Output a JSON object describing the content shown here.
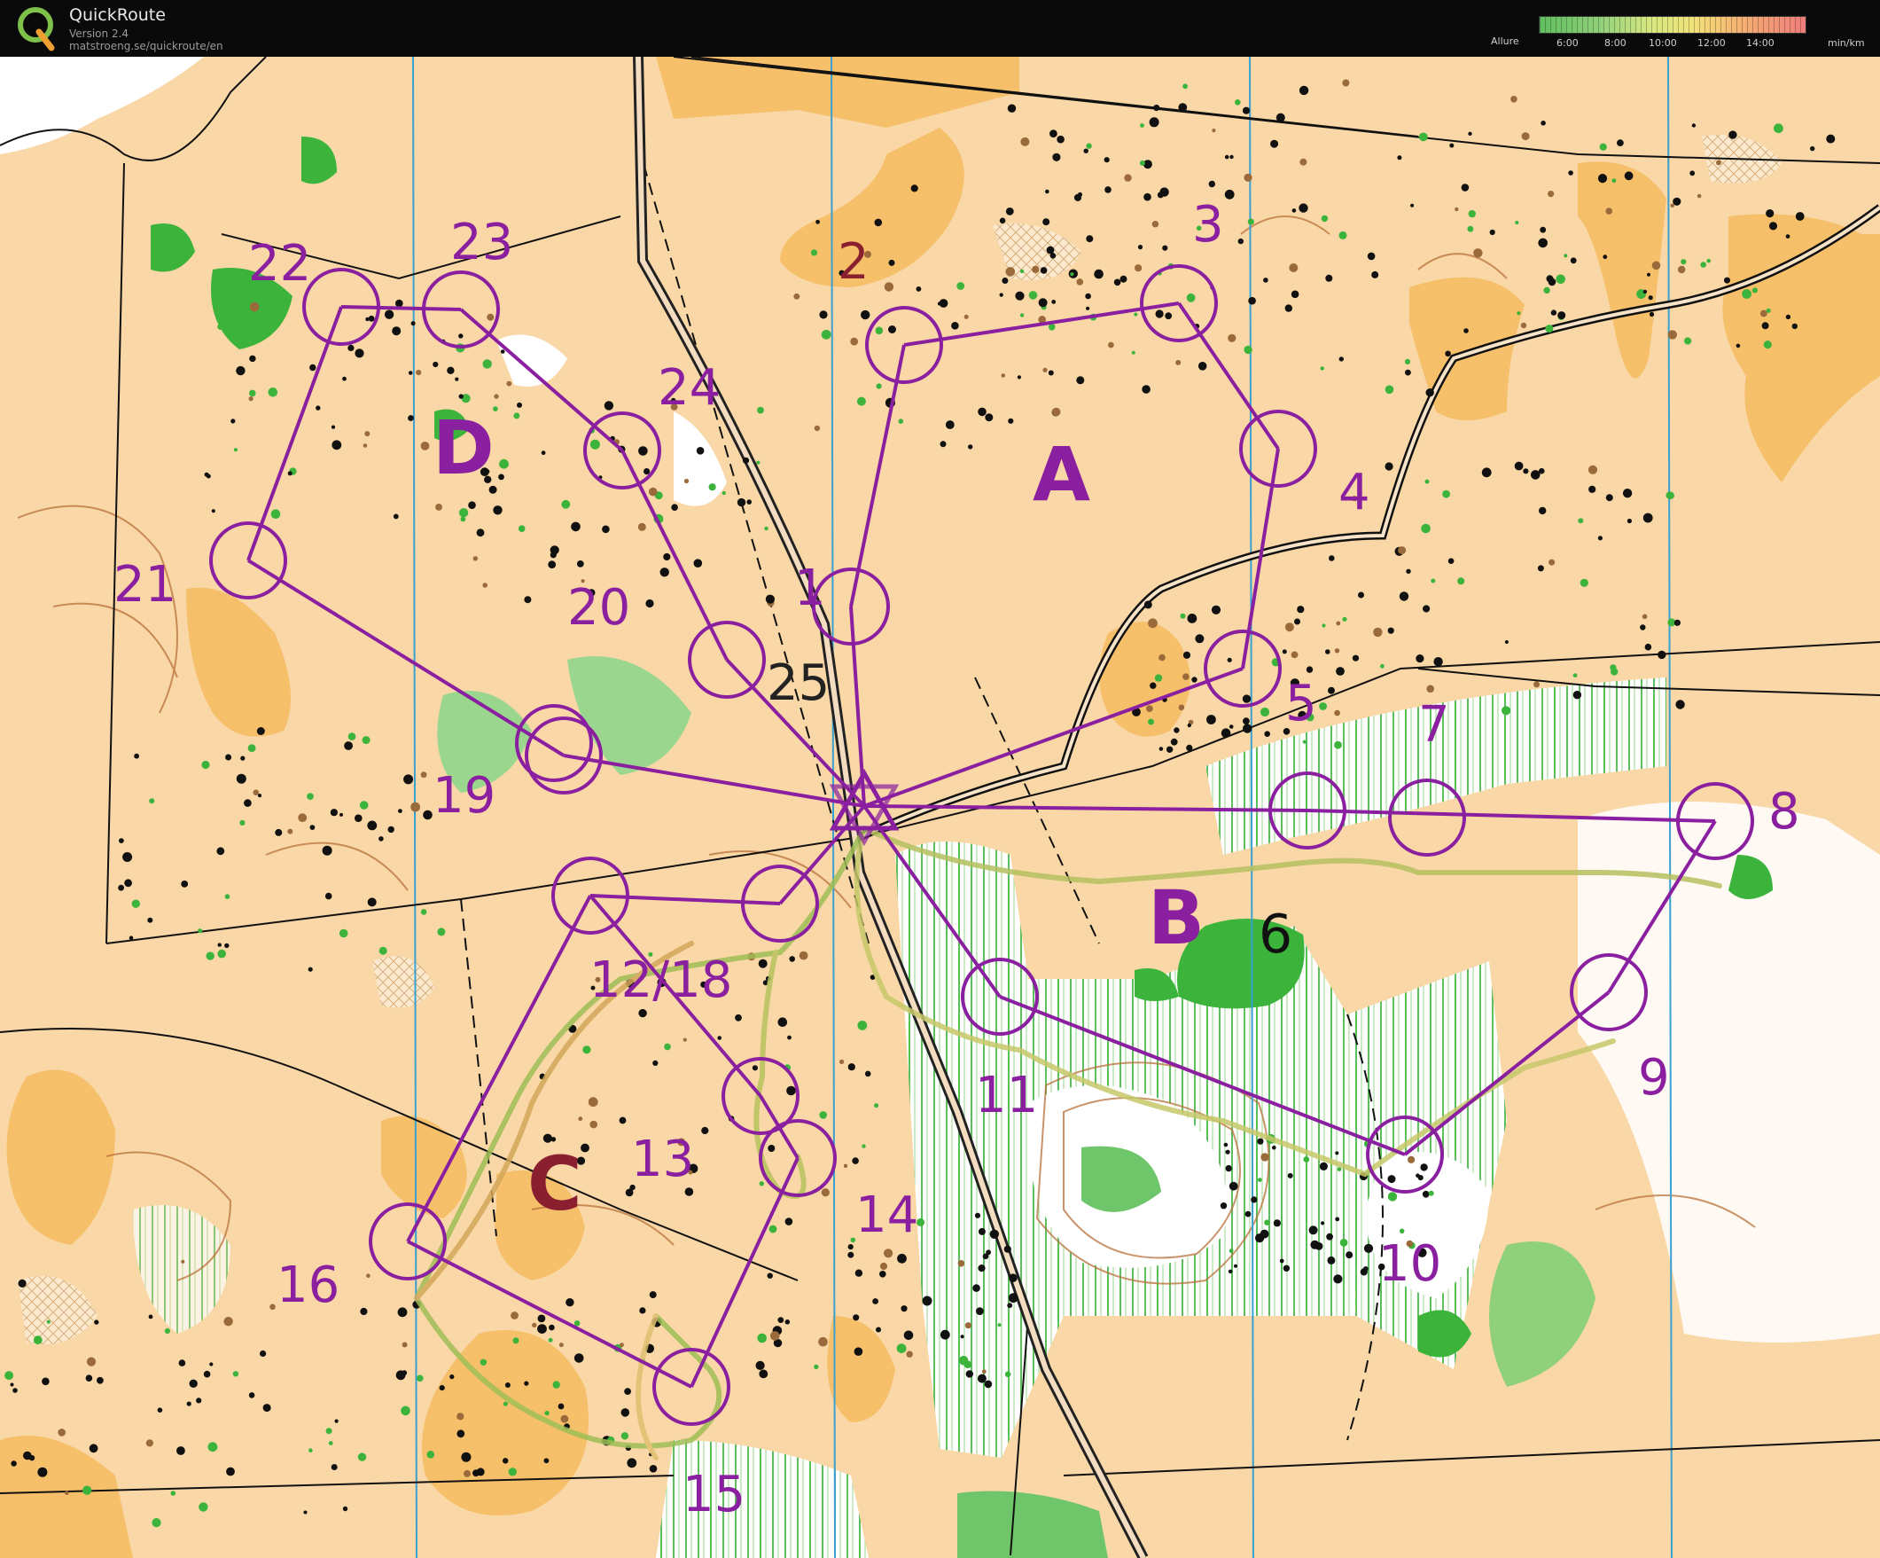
{
  "header": {
    "title": "QuickRoute",
    "version": "Version 2.4",
    "url": "matstroeng.se/quickroute/en"
  },
  "legend": {
    "label": "Allure",
    "unit": "min/km",
    "ticks": [
      "6:00",
      "8:00",
      "10:00",
      "12:00",
      "14:00"
    ]
  },
  "map": {
    "controls": [
      "1",
      "2",
      "3",
      "4",
      "5",
      "7",
      "8",
      "9",
      "10",
      "11",
      "12/18",
      "13",
      "14",
      "15",
      "16",
      "19",
      "20",
      "21",
      "22",
      "23",
      "24",
      "25"
    ],
    "loops": [
      "A",
      "B",
      "C",
      "D"
    ],
    "feature_label": "6"
  },
  "colors": {
    "course": "#8a1fa0",
    "open_land": "#f6c37a",
    "rough_open": "#f9d8a8",
    "forest_green": "#3fb53f",
    "contour": "#b8713a"
  }
}
